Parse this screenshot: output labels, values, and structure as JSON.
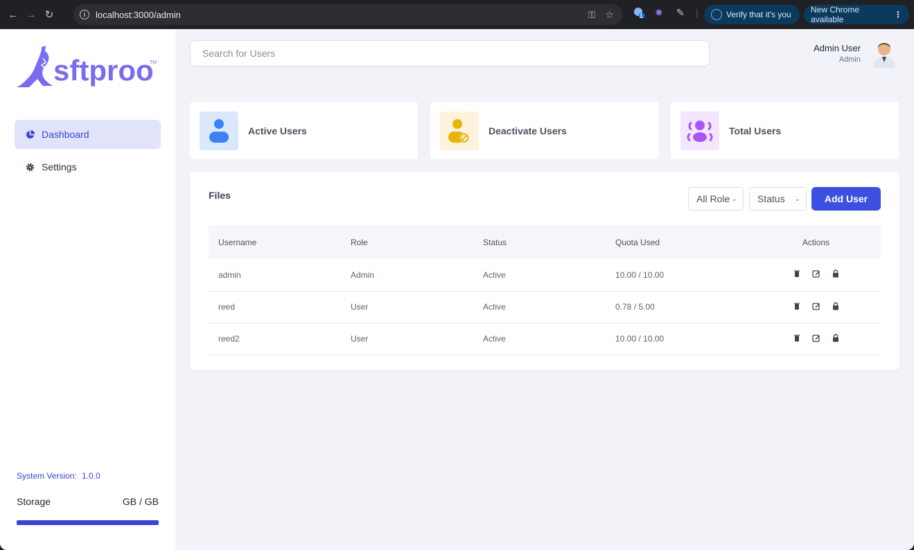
{
  "browser": {
    "url": "localhost:3000/admin",
    "extension_badge": "1",
    "verify_label": "Verify that it's you",
    "update_label": "New Chrome available"
  },
  "sidebar": {
    "logo_text": "sftproo",
    "logo_tm": "TM",
    "items": [
      {
        "label": "Dashboard",
        "icon": "pie-chart-icon",
        "active": true
      },
      {
        "label": "Settings",
        "icon": "gear-icon",
        "active": false
      }
    ],
    "system_version_label": "System Version:",
    "system_version": "1.0.0",
    "storage_label": "Storage",
    "storage_value": "GB / GB",
    "storage_fill": 1.0
  },
  "header": {
    "search_placeholder": "Search for Users",
    "user_name": "Admin User",
    "user_role": "Admin"
  },
  "stats": [
    {
      "label": "Active Users",
      "icon": "user-icon",
      "color": "#3b82f6",
      "bg": "#dbe8fc"
    },
    {
      "label": "Deactivate Users",
      "icon": "user-blocked-icon",
      "color": "#eab308",
      "bg": "#fdf3dc"
    },
    {
      "label": "Total Users",
      "icon": "users-group-icon",
      "color": "#a855f7",
      "bg": "#f3e6fd"
    }
  ],
  "panel": {
    "title": "Files",
    "role_filter": "All Role",
    "status_filter": "Status",
    "add_button": "Add User",
    "columns": [
      "Username",
      "Role",
      "Status",
      "Quota Used",
      "Actions"
    ],
    "rows": [
      {
        "username": "admin",
        "role": "Admin",
        "status": "Active",
        "quota": "10.00 / 10.00"
      },
      {
        "username": "reed",
        "role": "User",
        "status": "Active",
        "quota": "0.78 / 5.00"
      },
      {
        "username": "reed2",
        "role": "User",
        "status": "Active",
        "quota": "10.00 / 10.00"
      }
    ]
  },
  "colors": {
    "accent": "#3b43d6",
    "button": "#3b4fe0",
    "logo": "#7a6cf0"
  }
}
